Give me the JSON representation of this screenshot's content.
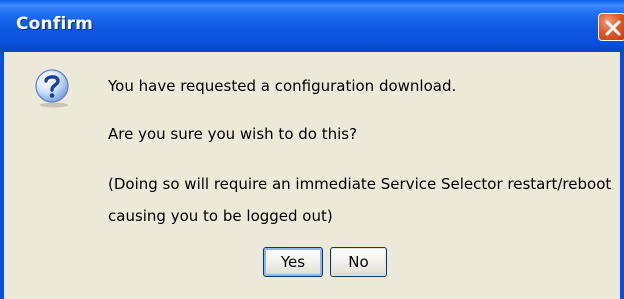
{
  "window": {
    "title": "Confirm",
    "close_icon": "close-icon",
    "message_icon": "question-icon"
  },
  "message": {
    "line1": "You have requested a configuration download.",
    "line2": "Are you sure you wish to do this?",
    "line3": "(Doing so will require an immediate Service Selector restart/reboot",
    "line4": "causing you to be logged out)"
  },
  "buttons": {
    "yes_label": "Yes",
    "no_label": "No"
  },
  "colors": {
    "titlebar": "#0a52db",
    "close_button": "#e05a2a",
    "dialog_background": "#ece9d8",
    "button_border": "#003c74"
  }
}
